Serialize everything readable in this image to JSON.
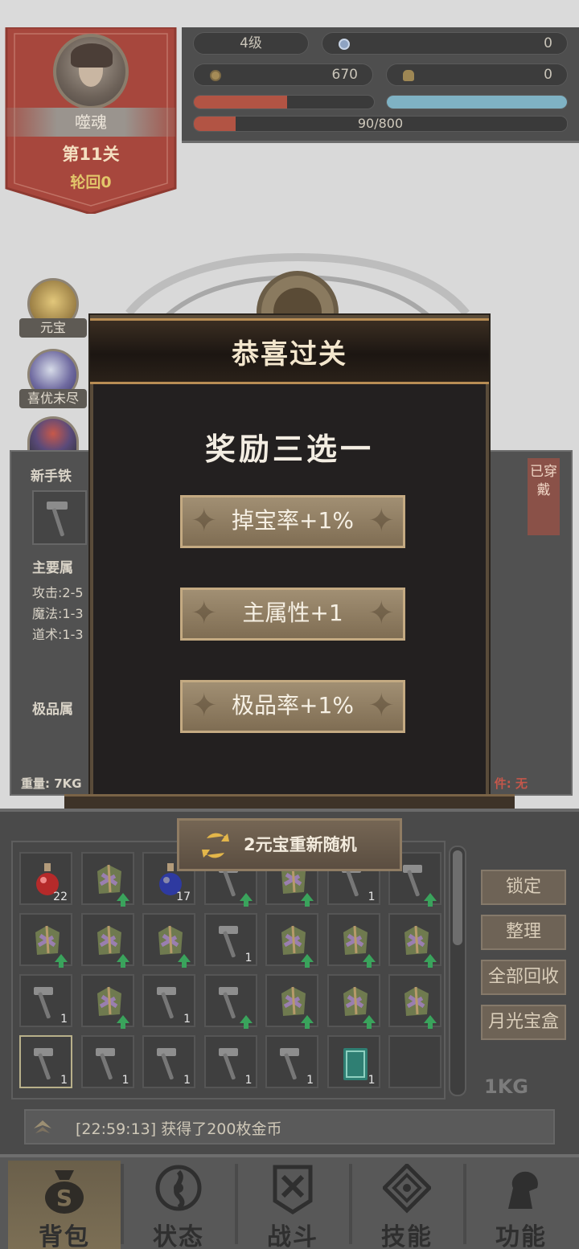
{
  "player": {
    "name": "噬魂",
    "stage": "第11关",
    "cycle": "轮回0",
    "level": "4级",
    "gem_value": "0",
    "coins": "670",
    "ingots": "0",
    "exp": "90/800",
    "hp_fraction": 0.52,
    "mp_fraction": 1.0,
    "exp_fraction": 0.1125
  },
  "side_icons": [
    {
      "label": "元宝",
      "icon": "gold-ingot-icon"
    },
    {
      "label": "喜优未尽",
      "icon": "orb-icon"
    },
    {
      "label": "",
      "icon": "crest-icon"
    }
  ],
  "equipment": {
    "name_partial": "新手铁",
    "main_attr_label": "主要属",
    "attack": "攻击:2-5",
    "magic": "魔法:1-3",
    "taoism": "道术:1-3",
    "extra_attr_label": "极品属",
    "weight_label": "重量: 7KG",
    "worn_tag": "已穿戴",
    "right_info": "件: 无"
  },
  "modal": {
    "title": "恭喜过关",
    "subtitle": "奖励三选一",
    "choices": [
      "掉宝率+1%",
      "主属性+1",
      "极品率+1%"
    ],
    "reroll_label": "2元宝重新随机"
  },
  "bag": {
    "rows": [
      [
        {
          "type": "red-potion",
          "count": "22",
          "up": false
        },
        {
          "type": "robe",
          "count": "",
          "up": true
        },
        {
          "type": "blue-potion",
          "count": "17",
          "up": false
        },
        {
          "type": "hammer",
          "count": "",
          "up": true
        },
        {
          "type": "robe",
          "count": "",
          "up": true
        },
        {
          "type": "hammer",
          "count": "1",
          "up": false
        },
        {
          "type": "hammer",
          "count": "",
          "up": true
        }
      ],
      [
        {
          "type": "robe",
          "count": "",
          "up": true
        },
        {
          "type": "robe",
          "count": "",
          "up": true
        },
        {
          "type": "robe",
          "count": "",
          "up": true
        },
        {
          "type": "hammer",
          "count": "1",
          "up": false
        },
        {
          "type": "robe",
          "count": "",
          "up": true
        },
        {
          "type": "robe",
          "count": "",
          "up": true
        },
        {
          "type": "robe",
          "count": "",
          "up": true
        }
      ],
      [
        {
          "type": "hammer",
          "count": "1",
          "up": false
        },
        {
          "type": "robe",
          "count": "",
          "up": true
        },
        {
          "type": "hammer",
          "count": "1",
          "up": false
        },
        {
          "type": "hammer",
          "count": "",
          "up": true
        },
        {
          "type": "robe",
          "count": "",
          "up": true
        },
        {
          "type": "robe",
          "count": "",
          "up": true
        },
        {
          "type": "robe",
          "count": "",
          "up": true
        }
      ],
      [
        {
          "type": "hammer",
          "count": "1",
          "up": false
        },
        {
          "type": "hammer",
          "count": "1",
          "up": false
        },
        {
          "type": "hammer",
          "count": "1",
          "up": false
        },
        {
          "type": "hammer",
          "count": "1",
          "up": false
        },
        {
          "type": "hammer",
          "count": "1",
          "up": false
        },
        {
          "type": "book",
          "count": "1",
          "up": false
        },
        {
          "type": "empty",
          "count": "",
          "up": false
        }
      ]
    ],
    "buttons": [
      "锁定",
      "整理",
      "全部回收",
      "月光宝盒"
    ],
    "weight": "1KG",
    "log": "[22:59:13] 获得了200枚金币"
  },
  "nav": [
    {
      "label": "背包",
      "icon": "bag-icon",
      "active": true
    },
    {
      "label": "状态",
      "icon": "status-icon",
      "active": false
    },
    {
      "label": "战斗",
      "icon": "battle-icon",
      "active": false
    },
    {
      "label": "技能",
      "icon": "skill-icon",
      "active": false
    },
    {
      "label": "功能",
      "icon": "function-icon",
      "active": false
    }
  ],
  "colors": {
    "hp": "#b25444",
    "mp": "#7fb2c4",
    "exp": "#b25444",
    "gold_text": "#e2c66a",
    "upgrade_arrow": "#3aa35c"
  }
}
